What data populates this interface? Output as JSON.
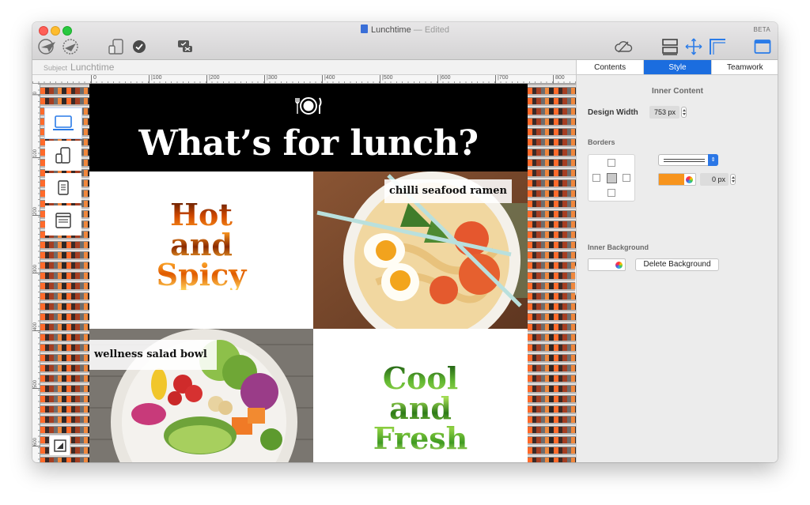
{
  "window": {
    "title": "Lunchtime",
    "title_status": "— Edited",
    "badge": "BETA"
  },
  "toolbar": {
    "icons": [
      "paper-plane-icon",
      "globe-settings-icon",
      "devices-icon",
      "checkmark-circle-icon",
      "chat-check-icon",
      "cloud-icon",
      "layout-icon",
      "move-crosshair-icon",
      "corner-icon",
      "sidebar-toggle-icon"
    ]
  },
  "subject": {
    "label": "Subject",
    "value": "Lunchtime"
  },
  "ruler": {
    "marks": [
      "0",
      "|100",
      "|200",
      "|300",
      "|400",
      "|500",
      "|600",
      "|700",
      "800"
    ],
    "vmarks": [
      "0",
      "100",
      "200",
      "300",
      "400",
      "500",
      "600"
    ]
  },
  "devices": [
    "laptop-icon",
    "tablet-phone-icon",
    "tablet-icon",
    "window-icon"
  ],
  "page": {
    "hero_title": "What’s for lunch?",
    "hot_lines": [
      "Hot",
      "and",
      "Spicy"
    ],
    "ramen_label": "chilli seafood ramen",
    "salad_label": "wellness salad bowl",
    "cool_lines": [
      "Cool",
      "and",
      "Fresh"
    ]
  },
  "inspector": {
    "tabs": [
      "Contents",
      "Style",
      "Teamwork"
    ],
    "active_tab": "Style",
    "section_title": "Inner Content",
    "design_width_label": "Design Width",
    "design_width_value": "753 px",
    "borders_label": "Borders",
    "border_color": "#f7941d",
    "border_width": "0 px",
    "inner_bg_label": "Inner Background",
    "delete_bg_label": "Delete Background"
  },
  "colors": {
    "accent": "#1b6ddf",
    "hero_bg": "#000000",
    "border_swatch": "#f7941d"
  }
}
